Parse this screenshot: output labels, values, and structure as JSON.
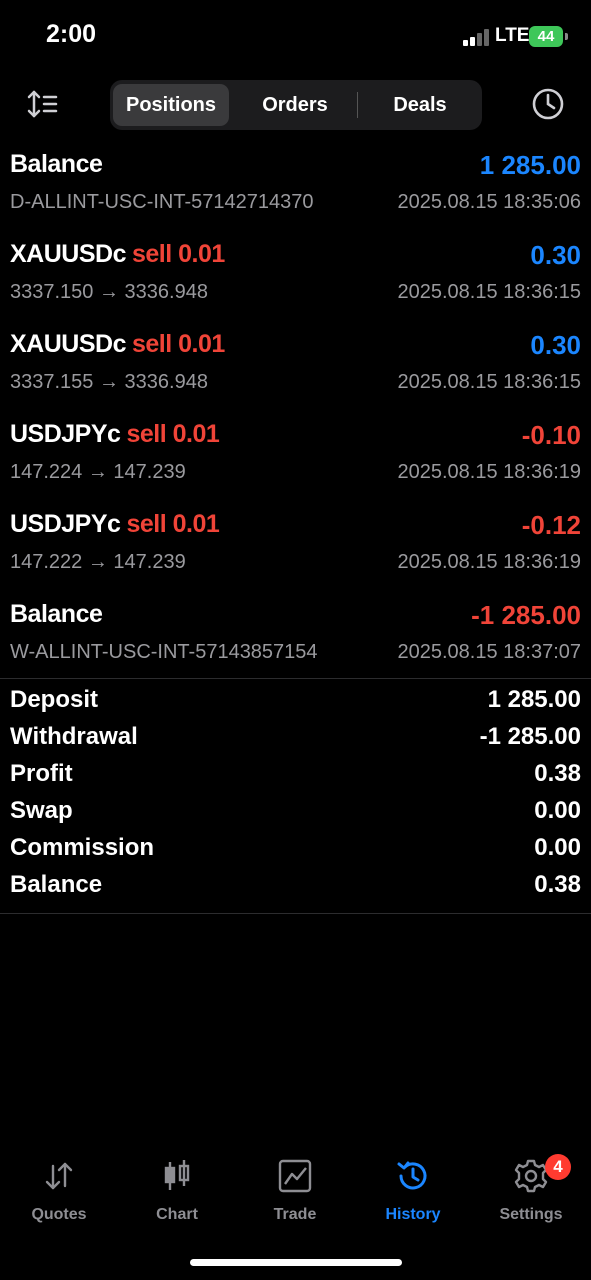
{
  "status_bar": {
    "time": "2:00",
    "network": "LTE",
    "battery": "44"
  },
  "toolbar": {
    "tabs": [
      {
        "label": "Positions"
      },
      {
        "label": "Orders"
      },
      {
        "label": "Deals"
      }
    ],
    "icons": {
      "sort": "sort-icon",
      "history_period": "clock-icon"
    }
  },
  "rows": [
    {
      "symbol": "Balance",
      "side": "",
      "amount": "1 285.00",
      "detail": "D-ALLINT-USC-INT-57142714370",
      "date": "2025.08.15 18:35:06"
    },
    {
      "symbol": "XAUUSDc",
      "side": "sell 0.01",
      "amount": "0.30",
      "detail": "3337.150 → 3336.948",
      "date": "2025.08.15 18:36:15"
    },
    {
      "symbol": "XAUUSDc",
      "side": "sell 0.01",
      "amount": "0.30",
      "detail": "3337.155 → 3336.948",
      "date": "2025.08.15 18:36:15"
    },
    {
      "symbol": "USDJPYc",
      "side": "sell 0.01",
      "amount": "-0.10",
      "detail": "147.224 → 147.239",
      "date": "2025.08.15 18:36:19"
    },
    {
      "symbol": "USDJPYc",
      "side": "sell 0.01",
      "amount": "-0.12",
      "detail": "147.222 → 147.239",
      "date": "2025.08.15 18:36:19"
    },
    {
      "symbol": "Balance",
      "side": "",
      "amount": "-1 285.00",
      "detail": "W-ALLINT-USC-INT-57143857154",
      "date": "2025.08.15 18:37:07"
    }
  ],
  "summary": [
    {
      "label": "Deposit",
      "value": "1 285.00"
    },
    {
      "label": "Withdrawal",
      "value": "-1 285.00"
    },
    {
      "label": "Profit",
      "value": "0.38"
    },
    {
      "label": "Swap",
      "value": "0.00"
    },
    {
      "label": "Commission",
      "value": "0.00"
    },
    {
      "label": "Balance",
      "value": "0.38"
    }
  ],
  "tabbar": {
    "items": [
      {
        "label": "Quotes",
        "icon": "quotes-icon"
      },
      {
        "label": "Chart",
        "icon": "chart-icon"
      },
      {
        "label": "Trade",
        "icon": "trade-icon"
      },
      {
        "label": "History",
        "icon": "history-icon"
      },
      {
        "label": "Settings",
        "icon": "gear-icon"
      }
    ],
    "active": "History",
    "settings_badge": "4"
  },
  "colors": {
    "positive": "#1b86ff",
    "negative": "#f04438",
    "muted": "#9a9a9e",
    "active_tab": "#1b86ff"
  }
}
